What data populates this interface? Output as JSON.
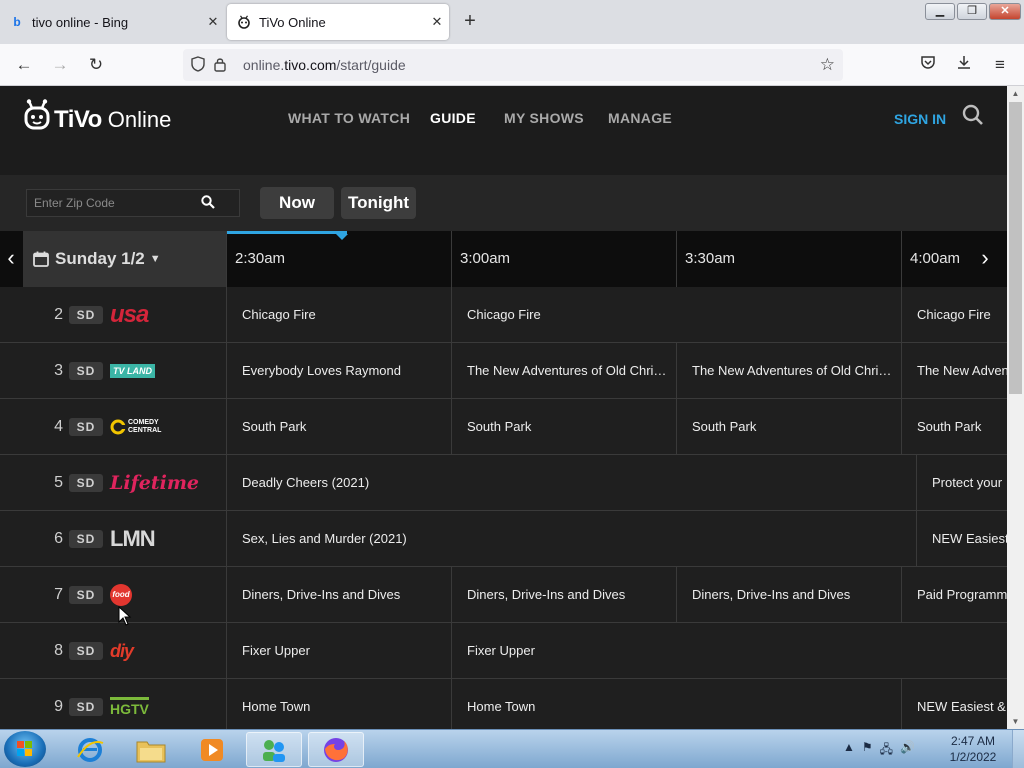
{
  "browser": {
    "tabs": [
      {
        "title": "tivo online - Bing",
        "favicon": "bing-icon"
      },
      {
        "title": "TiVo Online",
        "favicon": "tivo-icon"
      }
    ],
    "url_prefix": "online.",
    "url_domain": "tivo.com",
    "url_path": "/start/guide"
  },
  "header": {
    "brand": "TiVo",
    "brand_suffix": "Online",
    "nav": [
      "WHAT TO WATCH",
      "GUIDE",
      "MY SHOWS",
      "MANAGE"
    ],
    "active_nav": "GUIDE",
    "sign_in": "SIGN IN"
  },
  "filters": {
    "zip_placeholder": "Enter Zip Code",
    "now": "Now",
    "tonight": "Tonight"
  },
  "timeline": {
    "date": "Sunday 1/2",
    "slots": [
      "2:30am",
      "3:00am",
      "3:30am",
      "4:00am"
    ]
  },
  "channels": [
    {
      "number": "2",
      "quality": "SD",
      "logo": "usa-logo",
      "programs": [
        "Chicago Fire",
        "Chicago Fire",
        "Chicago Fire"
      ]
    },
    {
      "number": "3",
      "quality": "SD",
      "logo": "tvland-logo",
      "programs": [
        "Everybody Loves Raymond",
        "The New Adventures of Old Christine",
        "The New Adventures of Old Christine",
        "The New Adventures of Old Christine"
      ]
    },
    {
      "number": "4",
      "quality": "SD",
      "logo": "comedy-central-logo",
      "programs": [
        "South Park",
        "South Park",
        "South Park",
        "South Park"
      ]
    },
    {
      "number": "5",
      "quality": "SD",
      "logo": "lifetime-logo",
      "programs": [
        "Deadly Cheers (2021)",
        "Protect your"
      ]
    },
    {
      "number": "6",
      "quality": "SD",
      "logo": "lmn-logo",
      "programs": [
        "Sex, Lies and Murder (2021)",
        "NEW Easiest"
      ]
    },
    {
      "number": "7",
      "quality": "SD",
      "logo": "food-network-logo",
      "programs": [
        "Diners, Drive-Ins and Dives",
        "Diners, Drive-Ins and Dives",
        "Diners, Drive-Ins and Dives",
        "Paid Programming"
      ]
    },
    {
      "number": "8",
      "quality": "SD",
      "logo": "diy-logo",
      "programs": [
        "Fixer Upper",
        "Fixer Upper"
      ]
    },
    {
      "number": "9",
      "quality": "SD",
      "logo": "hgtv-logo",
      "programs": [
        "Home Town",
        "Home Town",
        "NEW Easiest & F"
      ]
    }
  ],
  "logos": {
    "usa": "usa",
    "tvland": "TV LAND",
    "comedy_central_1": "COMEDY",
    "comedy_central_2": "CENTRAL",
    "lifetime": "Lifetime",
    "lmn": "LMN",
    "food": "food",
    "diy": "diy",
    "hgtv": "HGTV"
  },
  "taskbar": {
    "time": "2:47 AM",
    "date": "1/2/2022"
  },
  "colors": {
    "accent": "#2fa5e2",
    "usa": "#d4253a",
    "tvland": "#3bb5a6",
    "lifetime": "#e0245e",
    "food": "#e2362f",
    "diy": "#e23b2a",
    "hgtv": "#7cba3b"
  }
}
